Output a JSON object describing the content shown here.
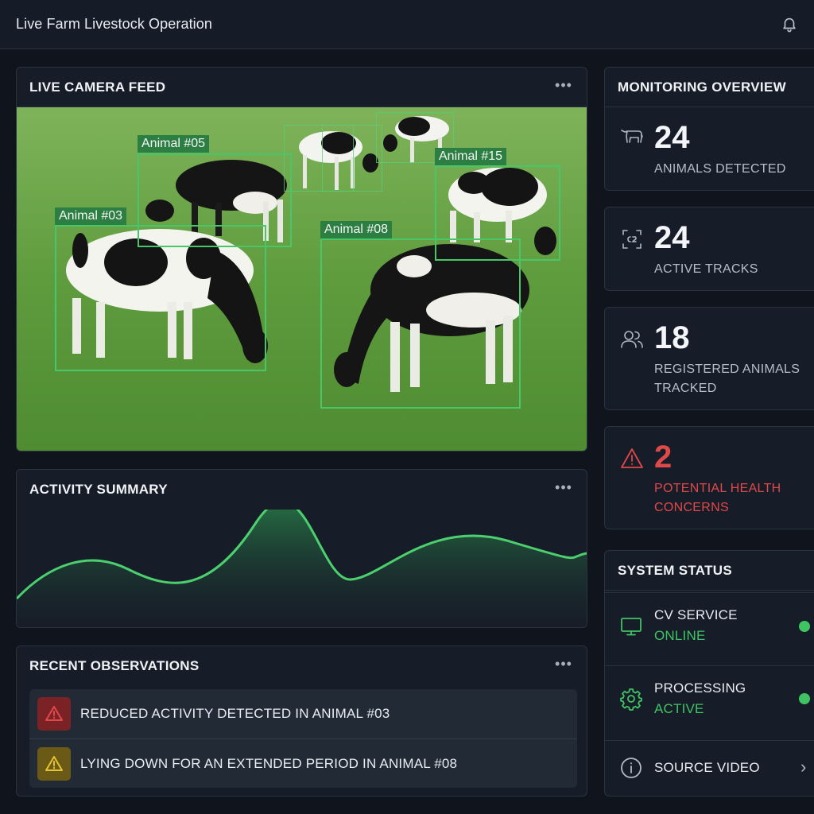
{
  "app": {
    "title": "Live Farm Livestock Operation",
    "notification_icon": "bell-icon"
  },
  "camera": {
    "title": "LIVE CAMERA FEED",
    "menu_icon": "more-horizontal-icon",
    "detections": [
      {
        "label": "Animal #05"
      },
      {
        "label": "Animal #15"
      },
      {
        "label": "Animal #03"
      },
      {
        "label": "Animal #08"
      }
    ]
  },
  "activity": {
    "title": "ACTIVITY SUMMARY",
    "menu_icon": "more-horizontal-icon",
    "line_color": "#4cd06e"
  },
  "observations": {
    "title": "RECENT OBSERVATIONS",
    "menu_icon": "more-horizontal-icon",
    "items": [
      {
        "text": "REDUCED ACTIVITY DETECTED IN ANIMAL #03",
        "severity": "critical",
        "icon": "alert-triangle-icon",
        "color": "#e0484a"
      },
      {
        "text": "LYING DOWN FOR AN EXTENDED PERIOD IN ANIMAL #08",
        "severity": "warning",
        "icon": "alert-triangle-icon",
        "color": "#e5c231"
      }
    ]
  },
  "overview": {
    "title": "MONITORING OVERVIEW",
    "stats": [
      {
        "value": "24",
        "label": "ANIMALS DETECTED",
        "icon": "cow-icon"
      },
      {
        "value": "24",
        "label": "ACTIVE TRACKS",
        "icon": "tracking-scan-icon"
      },
      {
        "value": "18",
        "label": "REGISTERED ANIMALS TRACKED",
        "icon": "users-icon"
      },
      {
        "value": "2",
        "label": "POTENTIAL HEALTH CONCERNS",
        "icon": "warning-icon",
        "color": "#e0484a"
      }
    ]
  },
  "system": {
    "title": "SYSTEM STATUS",
    "items": [
      {
        "name": "CV SERVICE",
        "value": "ONLINE",
        "icon": "monitor-icon",
        "status_color": "#3fc463"
      },
      {
        "name": "PROCESSING",
        "value": "ACTIVE",
        "icon": "gear-icon",
        "status_color": "#3fc463"
      },
      {
        "name": "SOURCE VIDEO",
        "icon": "info-icon"
      }
    ]
  }
}
